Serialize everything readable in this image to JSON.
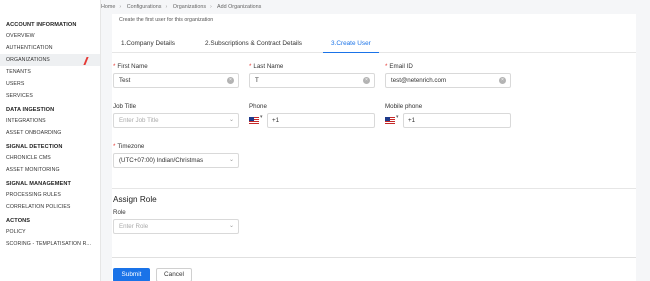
{
  "breadcrumb": [
    "Home",
    "Configurations",
    "Organizations",
    "Add Organizations"
  ],
  "sidebar": {
    "sections": [
      {
        "title": "ACCOUNT INFORMATION",
        "items": [
          "OVERVIEW",
          "AUTHENTICATION",
          "ORGANIZATIONS",
          "TENANTS",
          "USERS",
          "SERVICES"
        ]
      },
      {
        "title": "DATA INGESTION",
        "items": [
          "INTEGRATIONS",
          "ASSET ONBOARDING"
        ]
      },
      {
        "title": "SIGNAL DETECTION",
        "items": [
          "CHRONICLE CMS",
          "ASSET MONITORING"
        ]
      },
      {
        "title": "SIGNAL MANAGEMENT",
        "items": [
          "PROCESSING RULES",
          "CORRELATION POLICIES"
        ]
      },
      {
        "title": "ACTONS",
        "items": [
          "POLICY",
          "SCORING - TEMPLATISATION R..."
        ]
      }
    ],
    "active_item": "ORGANIZATIONS"
  },
  "form": {
    "subtitle": "Create the first user for this organization",
    "tabs": [
      "1.Company Details",
      "2.Subscriptions & Contract Details",
      "3.Create User"
    ],
    "active_tab": "3.Create User",
    "first_name": {
      "label": "First Name",
      "value": "Test"
    },
    "last_name": {
      "label": "Last Name",
      "value": "T"
    },
    "email": {
      "label": "Email ID",
      "value": "test@netenrich.com"
    },
    "job_title": {
      "label": "Job Title",
      "placeholder": "Enter Job Title"
    },
    "phone": {
      "label": "Phone",
      "value": "+1",
      "country_flag": "us-flag-icon"
    },
    "mobile": {
      "label": "Mobile phone",
      "value": "+1",
      "country_flag": "us-flag-icon"
    },
    "timezone": {
      "label": "Timezone",
      "value": "(UTC+07:00) Indian/Christmas"
    },
    "assign_role": {
      "heading": "Assign Role",
      "label": "Role",
      "placeholder": "Enter Role"
    },
    "submit_label": "Submit",
    "cancel_label": "Cancel",
    "required_marker": "*"
  },
  "colors": {
    "accent": "#1a73e8",
    "required": "#e53935",
    "active_marker": "#e53935"
  }
}
